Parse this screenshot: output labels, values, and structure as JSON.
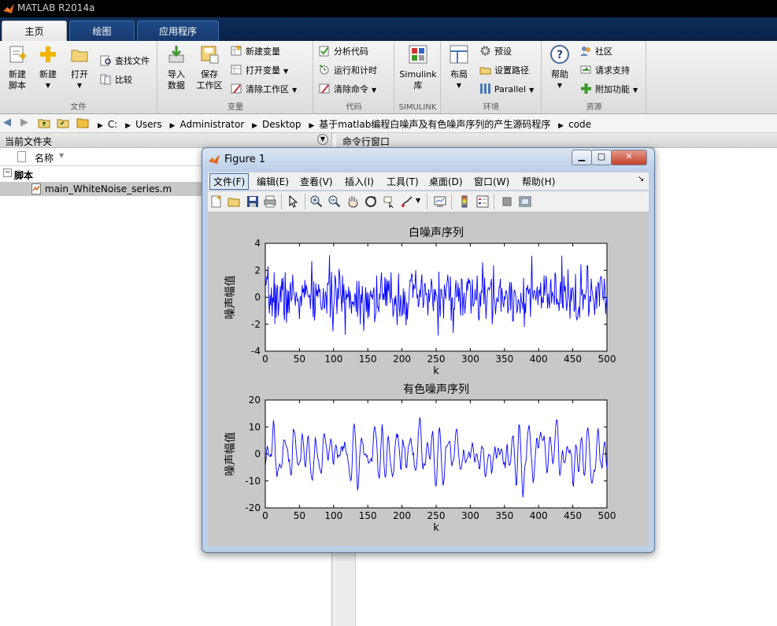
{
  "app": {
    "title": "MATLAB R2014a"
  },
  "tabs": [
    {
      "label": "主页",
      "active": true
    },
    {
      "label": "绘图"
    },
    {
      "label": "应用程序"
    }
  ],
  "ribbon": {
    "file": {
      "label": "文件",
      "new_script": "新建\n脚本",
      "new": "新建",
      "open": "打开",
      "find_files": "查找文件",
      "compare": "比较"
    },
    "variable": {
      "label": "变量",
      "import": "导入\n数据",
      "save_ws": "保存\n工作区",
      "new_var": "新建变量",
      "open_var": "打开变量",
      "clear_ws": "清除工作区"
    },
    "code": {
      "label": "代码",
      "analyze": "分析代码",
      "run_time": "运行和计时",
      "clear_cmd": "清除命令"
    },
    "simulink": {
      "label": "SIMULINK",
      "lib": "Simulink\n库"
    },
    "env": {
      "label": "环境",
      "layout": "布局",
      "prefs": "预设",
      "set_path": "设置路径",
      "parallel": "Parallel"
    },
    "resources": {
      "label": "资源",
      "help": "帮助",
      "community": "社区",
      "support": "请求支持",
      "addons": "附加功能"
    }
  },
  "address": {
    "crumbs": [
      "C:",
      "Users",
      "Administrator",
      "Desktop",
      "基于matlab编程白噪声及有色噪声序列的产生源码程序",
      "code"
    ]
  },
  "left_panel": {
    "title": "当前文件夹",
    "col_name": "名称",
    "group": "脚本",
    "file": "main_WhiteNoise_series.m"
  },
  "right_panel": {
    "title": "命令行窗口"
  },
  "figure": {
    "title": "Figure 1",
    "menu": [
      "文件(F)",
      "编辑(E)",
      "查看(V)",
      "插入(I)",
      "工具(T)",
      "桌面(D)",
      "窗口(W)",
      "帮助(H)"
    ],
    "colors": {
      "line": "#0000ff",
      "bg": "#c8c8c8"
    }
  },
  "chart_data": [
    {
      "type": "line",
      "title": "白噪声序列",
      "xlabel": "k",
      "ylabel": "噪声幅值",
      "xlim": [
        0,
        500
      ],
      "ylim": [
        -4,
        4
      ],
      "xticks": [
        0,
        50,
        100,
        150,
        200,
        250,
        300,
        350,
        400,
        450,
        500
      ],
      "yticks": [
        4,
        2,
        0,
        -2,
        -4
      ],
      "series": [
        {
          "seed": 7,
          "kind": "white",
          "n": 500,
          "std": 1.0
        }
      ]
    },
    {
      "type": "line",
      "title": "有色噪声序列",
      "xlabel": "k",
      "ylabel": "噪声幅值",
      "xlim": [
        0,
        500
      ],
      "ylim": [
        -20,
        20
      ],
      "xticks": [
        0,
        50,
        100,
        150,
        200,
        250,
        300,
        350,
        400,
        450,
        500
      ],
      "yticks": [
        20,
        10,
        0,
        -10,
        -20
      ],
      "series": [
        {
          "seed": 11,
          "kind": "colored",
          "n": 500,
          "amp": 14
        }
      ]
    }
  ]
}
